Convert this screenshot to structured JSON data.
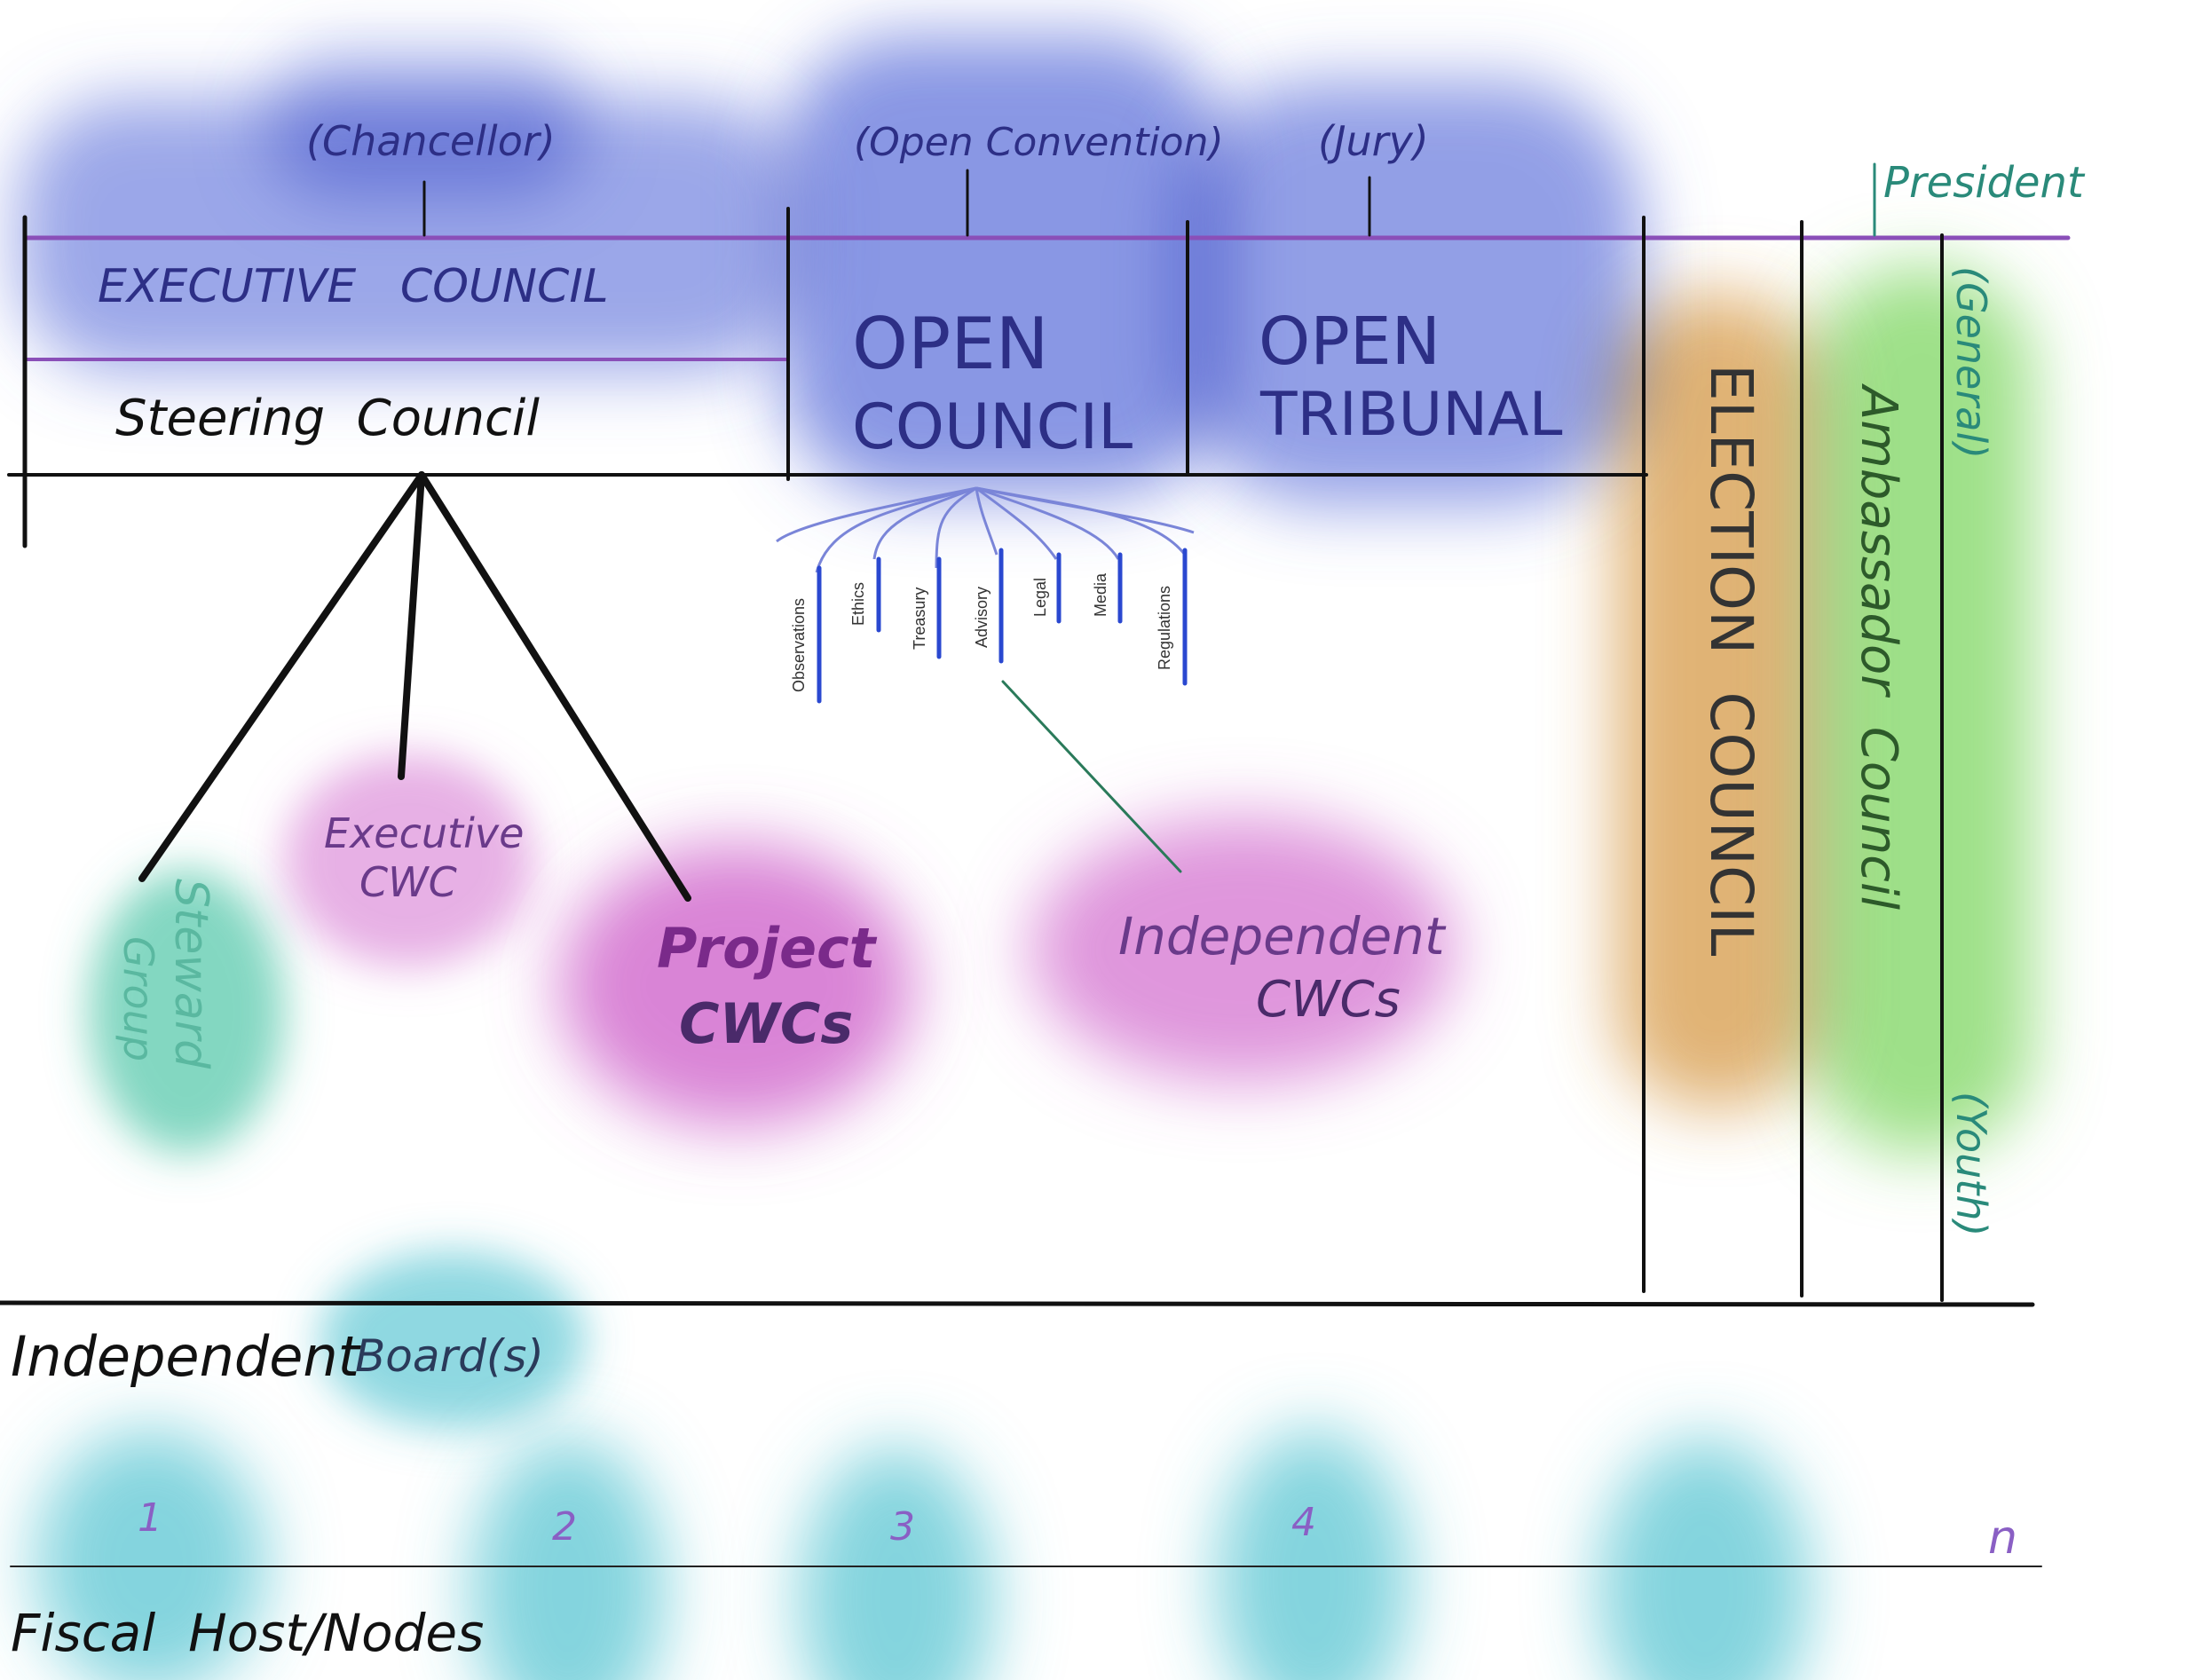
{
  "colors": {
    "ink": "#111111",
    "purple_line": "#8a4fb8",
    "blue_wash": "#4a5fd6",
    "blue_text": "#2d2f86",
    "magenta_wash": "#c94fc4",
    "magenta_text": "#6a3a8a",
    "teal_wash": "#3fc1a0",
    "cyan_wash": "#33b8c8",
    "orange_wash": "#d08a2a",
    "green_wash": "#6ad04a",
    "teal_text": "#2a8a7a",
    "number_text": "#8a5fc4",
    "committee_line": "#2a48d0"
  },
  "top_labels": {
    "chancellor": "(Chancellor)",
    "open_convention": "(Open Convention)",
    "jury": "(Jury)",
    "president": "President"
  },
  "councils": {
    "executive": "EXECUTIVE   COUNCIL",
    "steering": "Steering  Council",
    "open_council_line1": "OPEN",
    "open_council_line2": "COUNCIL",
    "open_tribunal_line1": "OPEN",
    "open_tribunal_line2": "TRIBUNAL",
    "election": "ELECTION  COUNCIL",
    "ambassador": "Ambassador  Council",
    "general": "(General)",
    "youth": "(Youth)"
  },
  "committees": [
    "Observations",
    "Ethics",
    "Treasury",
    "Advisory",
    "Legal",
    "Media",
    "Regulations"
  ],
  "groups": {
    "steward_line1": "Steward",
    "steward_line2": "Group",
    "executive_cwc_line1": "Executive",
    "executive_cwc_line2": "CWC",
    "project_cwcs_line1": "Project",
    "project_cwcs_line2": "CWCs",
    "independent_cwcs_line1": "Independent",
    "independent_cwcs_line2": "CWCs"
  },
  "bottom": {
    "independent": "Independent",
    "boards": "Board(s)",
    "nodes": [
      "1",
      "2",
      "3",
      "4",
      "n"
    ],
    "fiscal": "Fiscal  Host/Nodes"
  }
}
